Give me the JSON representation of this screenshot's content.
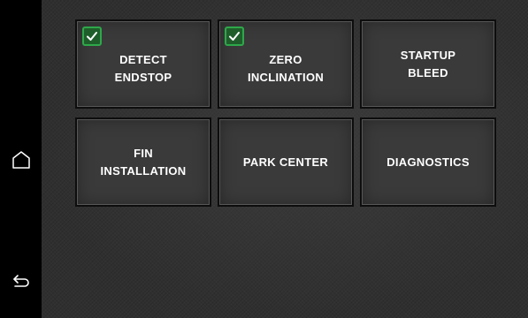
{
  "nav": {
    "home_icon": "home-icon",
    "back_icon": "back-arrow-icon"
  },
  "tiles": [
    {
      "label": "DETECT\nENDSTOP",
      "checked": true
    },
    {
      "label": "ZERO\nINCLINATION",
      "checked": true
    },
    {
      "label": "STARTUP\nBLEED",
      "checked": false
    },
    {
      "label": "FIN\nINSTALLATION",
      "checked": false
    },
    {
      "label": "PARK CENTER",
      "checked": false
    },
    {
      "label": "DIAGNOSTICS",
      "checked": false
    }
  ],
  "colors": {
    "check_green": "#2ea84a",
    "tile_bg": "#3a3a3a",
    "panel_bg": "#2f2f2f"
  }
}
